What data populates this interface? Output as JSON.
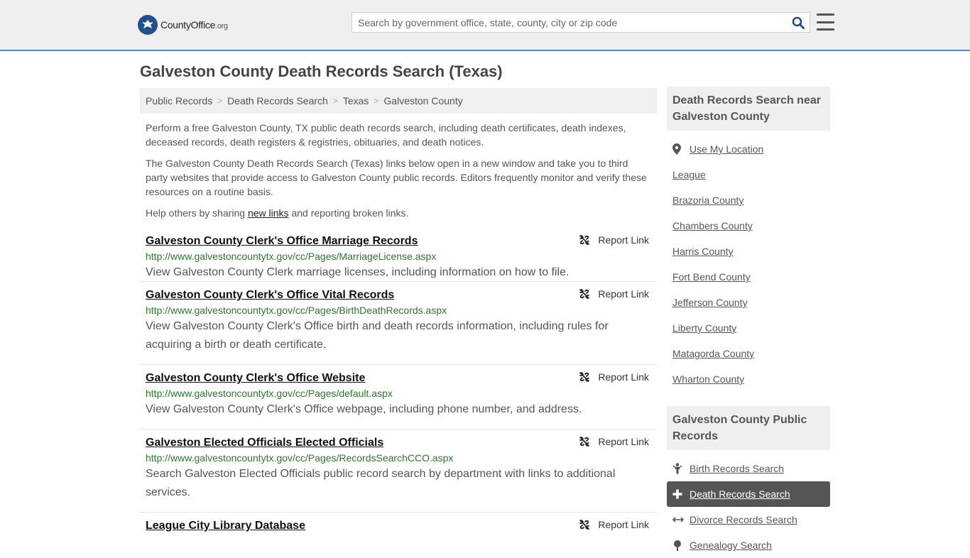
{
  "header": {
    "logo_main": "CountyOffice",
    "logo_suffix": ".org",
    "search_placeholder": "Search by government office, state, county, city or zip code"
  },
  "page_title": "Galveston County Death Records Search (Texas)",
  "breadcrumb": [
    "Public Records",
    "Death Records Search",
    "Texas",
    "Galveston County"
  ],
  "intro": {
    "p1": "Perform a free Galveston County, TX public death records search, including death certificates, death indexes, deceased records, death registers & registries, obituaries, and death notices.",
    "p2": "The Galveston County Death Records Search (Texas) links below open in a new window and take you to third party websites that provide access to Galveston County public records. Editors frequently monitor and verify these resources on a routine basis.",
    "p3_before": "Help others by sharing ",
    "p3_link": "new links",
    "p3_after": " and reporting broken links."
  },
  "report_label": "Report Link",
  "results": [
    {
      "title": "Galveston County Clerk's Office Marriage Records",
      "url": "http://www.galvestoncountytx.gov/cc/Pages/MarriageLicense.aspx",
      "desc": "View Galveston County Clerk marriage licenses, including information on how to file."
    },
    {
      "title": "Galveston County Clerk's Office Vital Records",
      "url": "http://www.galvestoncountytx.gov/cc/Pages/BirthDeathRecords.aspx",
      "desc": "View Galveston County Clerk's Office birth and death records information, including rules for acquiring a birth or death certificate."
    },
    {
      "title": "Galveston County Clerk's Office Website",
      "url": "http://www.galvestoncountytx.gov/cc/Pages/default.aspx",
      "desc": "View Galveston County Clerk's Office webpage, including phone number, and address."
    },
    {
      "title": "Galveston Elected Officials Elected Officials",
      "url": "http://www.galvestoncountytx.gov/cc/Pages/RecordsSearchCCO.aspx",
      "desc": "Search Galveston Elected Officials public record search by department with links to additional services."
    },
    {
      "title": "League City Library Database",
      "url": "",
      "desc": ""
    }
  ],
  "sidebar": {
    "near_title": "Death Records Search near Galveston County",
    "use_location": "Use My Location",
    "near_items": [
      "League",
      "Brazoria County",
      "Chambers County",
      "Harris County",
      "Fort Bend County",
      "Jefferson County",
      "Liberty County",
      "Matagorda County",
      "Wharton County"
    ],
    "public_title": "Galveston County Public Records",
    "public_items": [
      {
        "label": "Birth Records Search",
        "icon": "person-icon",
        "active": false
      },
      {
        "label": "Death Records Search",
        "icon": "plus-icon",
        "active": true
      },
      {
        "label": "Divorce Records Search",
        "icon": "arrows-horizontal-icon",
        "active": false
      },
      {
        "label": "Genealogy Search",
        "icon": "tree-icon",
        "active": false
      }
    ]
  },
  "colors": {
    "accent_border": "#4a8ad6",
    "url_green": "#2a7a2a",
    "logo_blue": "#1f4f8f"
  }
}
